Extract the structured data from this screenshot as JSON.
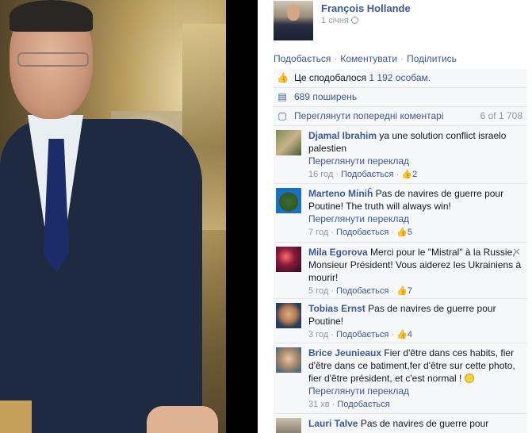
{
  "post": {
    "author": "François Hollande",
    "date": "1 січня"
  },
  "actions": {
    "like": "Подобається",
    "comment": "Коментувати",
    "share": "Поділитись",
    "separator": "·"
  },
  "likes_row": {
    "prefix": "Це сподобалося",
    "count": "1 192 особам."
  },
  "shares_row": {
    "text": "689 поширень"
  },
  "prev_row": {
    "text": "Переглянути попередні коментарі",
    "count": "6 of 1 708"
  },
  "comments": [
    {
      "name": "Djamal Ibrahim",
      "text": "ya une solution conflict israelo palestien",
      "translate": "Переглянути переклад",
      "time": "16 год",
      "like": "Подобається",
      "likes": "2"
    },
    {
      "name": "Marteno Miniĥ",
      "text": "Pas de navires de guerre pour Poutine! The truth will always win!",
      "translate": "Переглянути переклад",
      "time": "7 год",
      "like": "Подобається",
      "likes": "5"
    },
    {
      "name": "Mila Egorova",
      "text": "Merci pour le \"Mistral\" à la Russie, Monsieur Président! Vous aiderez les Ukrainiens à mourir!",
      "time": "5 год",
      "like": "Подобається",
      "likes": "7"
    },
    {
      "name": "Tobias Ernst",
      "text": "Pas de navires de guerre pour Poutine!",
      "time": "3 год",
      "like": "Подобається",
      "likes": "4"
    },
    {
      "name": "Brice Jeunieaux",
      "text": "Fier d'être dans ces habits, fier d'être dans ce batiment,fer d'être sur cette photo, fier d'être président, et c'est normal !",
      "translate": "Переглянути переклад",
      "time": "31 хв",
      "like": "Подобається"
    },
    {
      "name": "Lauri Talve",
      "text": "Pas de navires de guerre pour"
    }
  ],
  "icons": {
    "like": "thumbs-up-icon",
    "share": "share-icon",
    "comments": "comments-icon",
    "close": "close-icon",
    "globe": "globe-icon",
    "smile": "smile-emoji-icon"
  }
}
